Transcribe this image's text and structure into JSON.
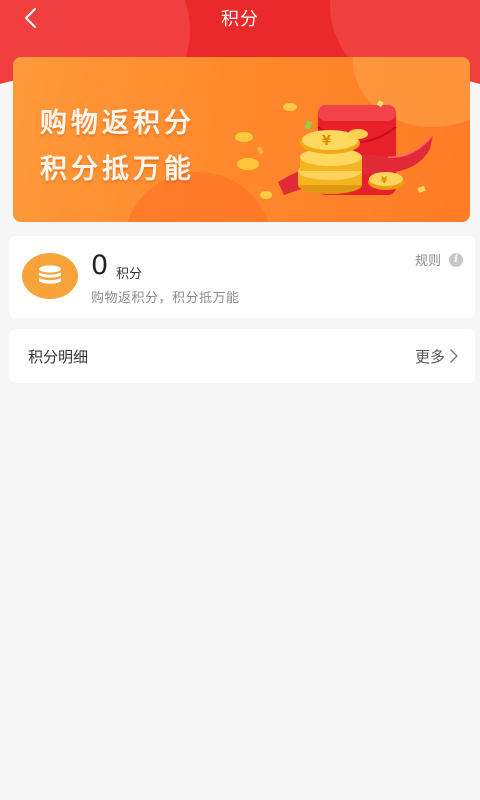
{
  "nav": {
    "title": "积分",
    "back_icon": "chevron-left-icon"
  },
  "banner": {
    "line1": "购物返积分",
    "line2": "积分抵万能"
  },
  "points": {
    "value": "0",
    "unit": "积分",
    "description": "购物返积分，积分抵万能",
    "rules_label": "规则",
    "info_icon_glyph": "i"
  },
  "details": {
    "label": "积分明细",
    "more_label": "更多"
  },
  "colors": {
    "header_red": "#ea2a2a",
    "banner_orange": "#ff8a2c",
    "coin_badge": "#f7a33a",
    "page_bg": "#f6f6f6"
  }
}
